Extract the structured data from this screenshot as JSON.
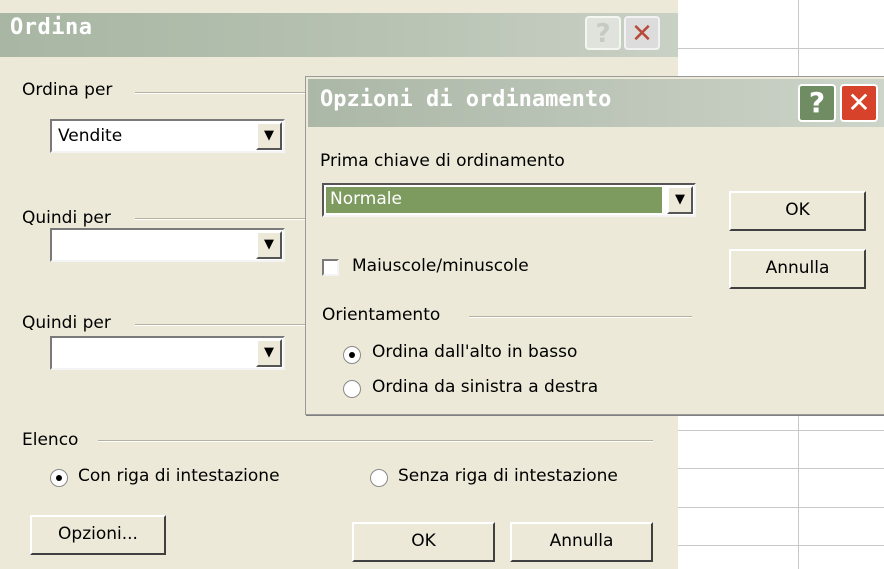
{
  "main_dialog": {
    "title": "Ordina",
    "help_glyph": "?",
    "close_glyph": "✕",
    "sort_by_label": "Ordina per",
    "sort_by_value": "Vendite",
    "then_by_1_label": "Quindi per",
    "then_by_1_value": "",
    "then_by_2_label": "Quindi per",
    "then_by_2_value": "",
    "list_label": "Elenco",
    "header_row_yes": "Con riga di intestazione",
    "header_row_no": "Senza riga di intestazione",
    "options_button": "Opzioni...",
    "ok_button": "OK",
    "cancel_button": "Annulla"
  },
  "options_dialog": {
    "title": "Opzioni di ordinamento",
    "help_glyph": "?",
    "close_glyph": "✕",
    "first_key_label": "Prima chiave di ordinamento",
    "first_key_value": "Normale",
    "case_sensitive_label": "Maiuscole/minuscole",
    "case_sensitive_checked": false,
    "orientation_label": "Orientamento",
    "orient_top_bottom": "Ordina dall'alto in basso",
    "orient_left_right": "Ordina da sinistra a destra",
    "selected_orientation": "top_bottom",
    "ok_button": "OK",
    "cancel_button": "Annulla"
  },
  "icons": {
    "dropdown_arrow": "▼"
  },
  "colors": {
    "dialog_bg": "#ece9d8",
    "selected_field": "#7d9a5f"
  }
}
